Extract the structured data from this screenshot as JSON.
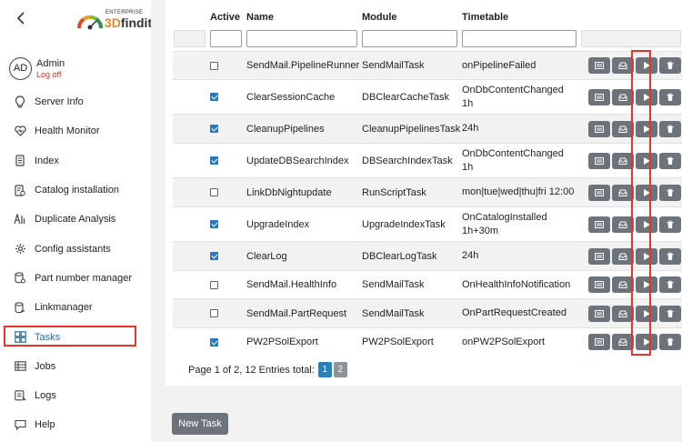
{
  "sidebar": {
    "logo_small": "ENTERPRISE",
    "logo_main_prefix": "3D",
    "logo_main_suffix": "findit",
    "user": {
      "initials": "AD",
      "name": "Admin",
      "logoff": "Log off"
    },
    "items": [
      {
        "label": "Server Info",
        "icon": "lightbulb-icon"
      },
      {
        "label": "Health Monitor",
        "icon": "heart-icon"
      },
      {
        "label": "Index",
        "icon": "index-icon"
      },
      {
        "label": "Catalog installation",
        "icon": "catalog-icon"
      },
      {
        "label": "Duplicate Analysis",
        "icon": "duplicate-icon"
      },
      {
        "label": "Config assistants",
        "icon": "gear-icon"
      },
      {
        "label": "Part number manager",
        "icon": "database-icon"
      },
      {
        "label": "Linkmanager",
        "icon": "link-icon"
      },
      {
        "label": "Tasks",
        "icon": "grid-icon",
        "active": true
      },
      {
        "label": "Jobs",
        "icon": "list-icon"
      },
      {
        "label": "Logs",
        "icon": "log-icon"
      },
      {
        "label": "Help",
        "icon": "help-icon"
      }
    ]
  },
  "table": {
    "headers": {
      "active": "Active",
      "name": "Name",
      "module": "Module",
      "timetable": "Timetable"
    },
    "rows": [
      {
        "active": false,
        "name": "SendMail.PipelineRunner",
        "module": "SendMailTask",
        "timetable": [
          "onPipelineFailed"
        ]
      },
      {
        "active": true,
        "name": "ClearSessionCache",
        "module": "DBClearCacheTask",
        "timetable": [
          "OnDbContentChanged",
          "1h"
        ]
      },
      {
        "active": true,
        "name": "CleanupPipelines",
        "module": "CleanupPipelinesTask",
        "timetable": [
          "24h"
        ]
      },
      {
        "active": true,
        "name": "UpdateDBSearchIndex",
        "module": "DBSearchIndexTask",
        "timetable": [
          "OnDbContentChanged",
          "1h"
        ]
      },
      {
        "active": false,
        "name": "LinkDbNightupdate",
        "module": "RunScriptTask",
        "timetable": [
          "mon|tue|wed|thu|fri 12:00"
        ]
      },
      {
        "active": true,
        "name": "UpgradeIndex",
        "module": "UpgradeIndexTask",
        "timetable": [
          "OnCatalogInstalled",
          "1h+30m"
        ]
      },
      {
        "active": true,
        "name": "ClearLog",
        "module": "DBClearLogTask",
        "timetable": [
          "24h"
        ]
      },
      {
        "active": false,
        "name": "SendMail.HealthInfo",
        "module": "SendMailTask",
        "timetable": [
          "OnHealthInfoNotification"
        ]
      },
      {
        "active": false,
        "name": "SendMail.PartRequest",
        "module": "SendMailTask",
        "timetable": [
          "OnPartRequestCreated"
        ]
      },
      {
        "active": true,
        "name": "PW2PSolExport",
        "module": "PW2PSolExport",
        "timetable": [
          "onPW2PSolExport"
        ]
      }
    ],
    "action_icons": [
      "details-icon",
      "inbox-icon",
      "play-icon",
      "trash-icon"
    ]
  },
  "pager": {
    "text": "Page 1 of 2, 12 Entries total:",
    "pages": [
      "1",
      "2"
    ],
    "current": "1"
  },
  "new_task_label": "New Task",
  "colors": {
    "accent": "#2a6f9b",
    "highlight": "#e8322a",
    "button": "#6d737a",
    "checkbox": "#2679c8"
  }
}
